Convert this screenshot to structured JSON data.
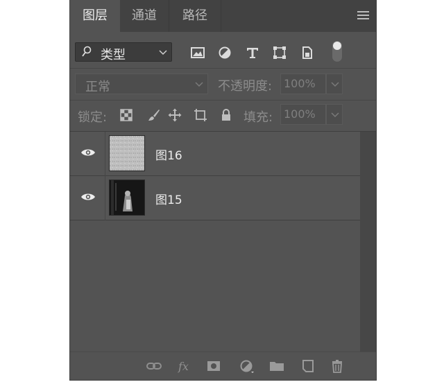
{
  "tabs": [
    {
      "label": "图层",
      "active": true
    },
    {
      "label": "通道",
      "active": false
    },
    {
      "label": "路径",
      "active": false
    }
  ],
  "filter": {
    "kind_label": "类型",
    "icons": [
      "image-filter-icon",
      "adjustment-filter-icon",
      "type-filter-icon",
      "shape-filter-icon",
      "smart-object-filter-icon",
      "filter-toggle"
    ]
  },
  "blend": {
    "mode_label": "正常",
    "opacity_label": "不透明度:",
    "opacity_value": "100%"
  },
  "lock": {
    "label": "锁定:",
    "icons": [
      "lock-transparent-pixels-icon",
      "lock-image-pixels-icon",
      "lock-position-icon",
      "lock-artboard-icon",
      "lock-all-icon"
    ],
    "fill_label": "填充:",
    "fill_value": "100%"
  },
  "layers": [
    {
      "name": "图16",
      "visible": true,
      "thumb": "light-texture"
    },
    {
      "name": "图15",
      "visible": true,
      "thumb": "dark-photo"
    }
  ],
  "bottom_icons": [
    "link-layers-icon",
    "fx-icon",
    "add-mask-icon",
    "adjustment-layer-icon",
    "new-group-icon",
    "new-layer-icon",
    "delete-layer-icon"
  ],
  "colors": {
    "panel_bg": "#535353",
    "tabbar_bg": "#424242",
    "layer_bg": "#555555"
  }
}
